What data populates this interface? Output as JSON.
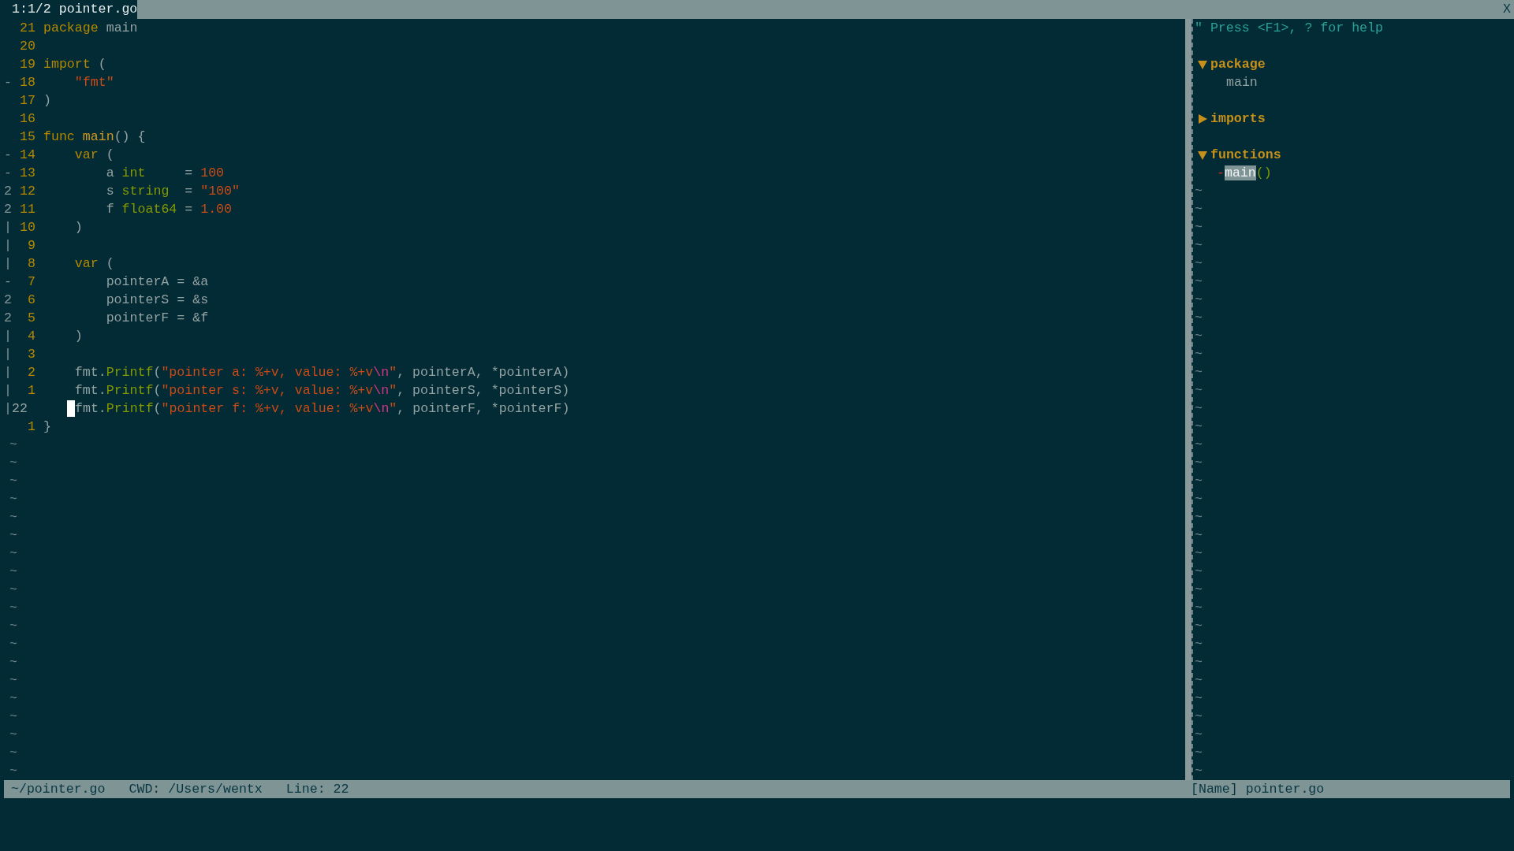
{
  "tabline": {
    "tabs": [
      {
        "label": "1:1/2 pointer.go",
        "selected": true
      }
    ],
    "close": "X"
  },
  "code_lines": [
    {
      "number": "21",
      "tokens": [
        {
          "kind": "keyword",
          "text": "package"
        },
        {
          "kind": "plain",
          "text": " main"
        }
      ]
    },
    {
      "number": "20"
    },
    {
      "number": "19",
      "tokens": [
        {
          "kind": "keyword",
          "text": "import"
        },
        {
          "kind": "plain",
          "text": " ("
        }
      ]
    },
    {
      "sign": "-",
      "number": "18",
      "tokens": [
        {
          "kind": "string",
          "text": "    \"fmt\""
        }
      ]
    },
    {
      "number": "17",
      "tokens": [
        {
          "kind": "plain",
          "text": ")"
        }
      ]
    },
    {
      "number": "16"
    },
    {
      "number": "15",
      "tokens": [
        {
          "kind": "keyword",
          "text": "func"
        },
        {
          "kind": "function",
          "text": " main"
        },
        {
          "kind": "plain",
          "text": "() {"
        }
      ]
    },
    {
      "sign": "-",
      "number": "14",
      "tokens": [
        {
          "kind": "keyword",
          "text": "    var"
        },
        {
          "kind": "plain",
          "text": " ("
        }
      ]
    },
    {
      "sign": "-",
      "number": "13",
      "tokens": [
        {
          "kind": "plain",
          "text": "        a "
        },
        {
          "kind": "type",
          "text": "int"
        },
        {
          "kind": "plain",
          "text": "     = "
        },
        {
          "kind": "number",
          "text": "100"
        }
      ]
    },
    {
      "sign": "2",
      "number": "12",
      "tokens": [
        {
          "kind": "plain",
          "text": "        s "
        },
        {
          "kind": "type",
          "text": "string"
        },
        {
          "kind": "plain",
          "text": "  = "
        },
        {
          "kind": "string",
          "text": "\"100\""
        }
      ]
    },
    {
      "sign": "2",
      "number": "11",
      "tokens": [
        {
          "kind": "plain",
          "text": "        f "
        },
        {
          "kind": "type",
          "text": "float64"
        },
        {
          "kind": "plain",
          "text": " = "
        },
        {
          "kind": "number",
          "text": "1.00"
        }
      ]
    },
    {
      "sign": "|",
      "number": "10",
      "tokens": [
        {
          "kind": "plain",
          "text": "    )"
        }
      ]
    },
    {
      "sign": "|",
      "number": "9"
    },
    {
      "sign": "|",
      "number": "8",
      "tokens": [
        {
          "kind": "keyword",
          "text": "    var"
        },
        {
          "kind": "plain",
          "text": " ("
        }
      ]
    },
    {
      "sign": "-",
      "number": "7",
      "tokens": [
        {
          "kind": "plain",
          "text": "        pointerA = &a"
        }
      ]
    },
    {
      "sign": "2",
      "number": "6",
      "tokens": [
        {
          "kind": "plain",
          "text": "        pointerS = &s"
        }
      ]
    },
    {
      "sign": "2",
      "number": "5",
      "tokens": [
        {
          "kind": "plain",
          "text": "        pointerF = &f"
        }
      ]
    },
    {
      "sign": "|",
      "number": "4",
      "tokens": [
        {
          "kind": "plain",
          "text": "    )"
        }
      ]
    },
    {
      "sign": "|",
      "number": "3"
    },
    {
      "sign": "|",
      "number": "2",
      "tokens": [
        {
          "kind": "plain",
          "text": "    fmt."
        },
        {
          "kind": "method",
          "text": "Printf"
        },
        {
          "kind": "plain",
          "text": "("
        },
        {
          "kind": "string",
          "text": "\"pointer a: %+v, value: %+v"
        },
        {
          "kind": "escape",
          "text": "\\n"
        },
        {
          "kind": "string",
          "text": "\""
        },
        {
          "kind": "plain",
          "text": ", pointerA, *pointerA)"
        }
      ]
    },
    {
      "sign": "|",
      "number": "1",
      "tokens": [
        {
          "kind": "plain",
          "text": "    fmt."
        },
        {
          "kind": "method",
          "text": "Printf"
        },
        {
          "kind": "plain",
          "text": "("
        },
        {
          "kind": "string",
          "text": "\"pointer s: %+v, value: %+v"
        },
        {
          "kind": "escape",
          "text": "\\n"
        },
        {
          "kind": "string",
          "text": "\""
        },
        {
          "kind": "plain",
          "text": ", pointerS, *pointerS)"
        }
      ]
    },
    {
      "sign": "|",
      "number": "22",
      "cursor": true,
      "tokens": [
        {
          "kind": "plain",
          "text": "fmt."
        },
        {
          "kind": "method",
          "text": "Printf"
        },
        {
          "kind": "plain",
          "text": "("
        },
        {
          "kind": "string",
          "text": "\"pointer f: %+v, value: %+v"
        },
        {
          "kind": "escape",
          "text": "\\n"
        },
        {
          "kind": "string",
          "text": "\""
        },
        {
          "kind": "plain",
          "text": ", pointerF, *pointerF)"
        }
      ]
    },
    {
      "number": "1",
      "tokens": [
        {
          "kind": "plain",
          "text": "}"
        }
      ]
    }
  ],
  "empty_lines": [
    "~",
    "~",
    "~",
    "~",
    "~",
    "~",
    "~",
    "~",
    "~",
    "~",
    "~",
    "~",
    "~",
    "~",
    "~",
    "~",
    "~",
    "~",
    "~"
  ],
  "tagbar": {
    "help": "\" Press <F1>, ? for help",
    "sections": [
      {
        "label": "package",
        "expanded": true,
        "children": [
          {
            "kind": "plain",
            "name": "main"
          }
        ]
      },
      {
        "label": "imports",
        "expanded": false
      },
      {
        "label": "functions",
        "expanded": true,
        "children": [
          {
            "kind": "function",
            "prefix": "-",
            "name": "main",
            "suffix": "()",
            "selected": true
          }
        ]
      }
    ],
    "empty_lines": [
      "~",
      "~",
      "~",
      "~",
      "~",
      "~",
      "~",
      "~",
      "~",
      "~",
      "~",
      "~",
      "~",
      "~",
      "~",
      "~",
      "~",
      "~",
      "~",
      "~",
      "~",
      "~",
      "~",
      "~",
      "~",
      "~",
      "~",
      "~",
      "~",
      "~",
      "~",
      "~",
      "~"
    ]
  },
  "status_bar": {
    "left": [
      "~/pointer.go",
      "CWD: /Users/wentx",
      "Line: 22"
    ],
    "right": "[Name] pointer.go"
  }
}
